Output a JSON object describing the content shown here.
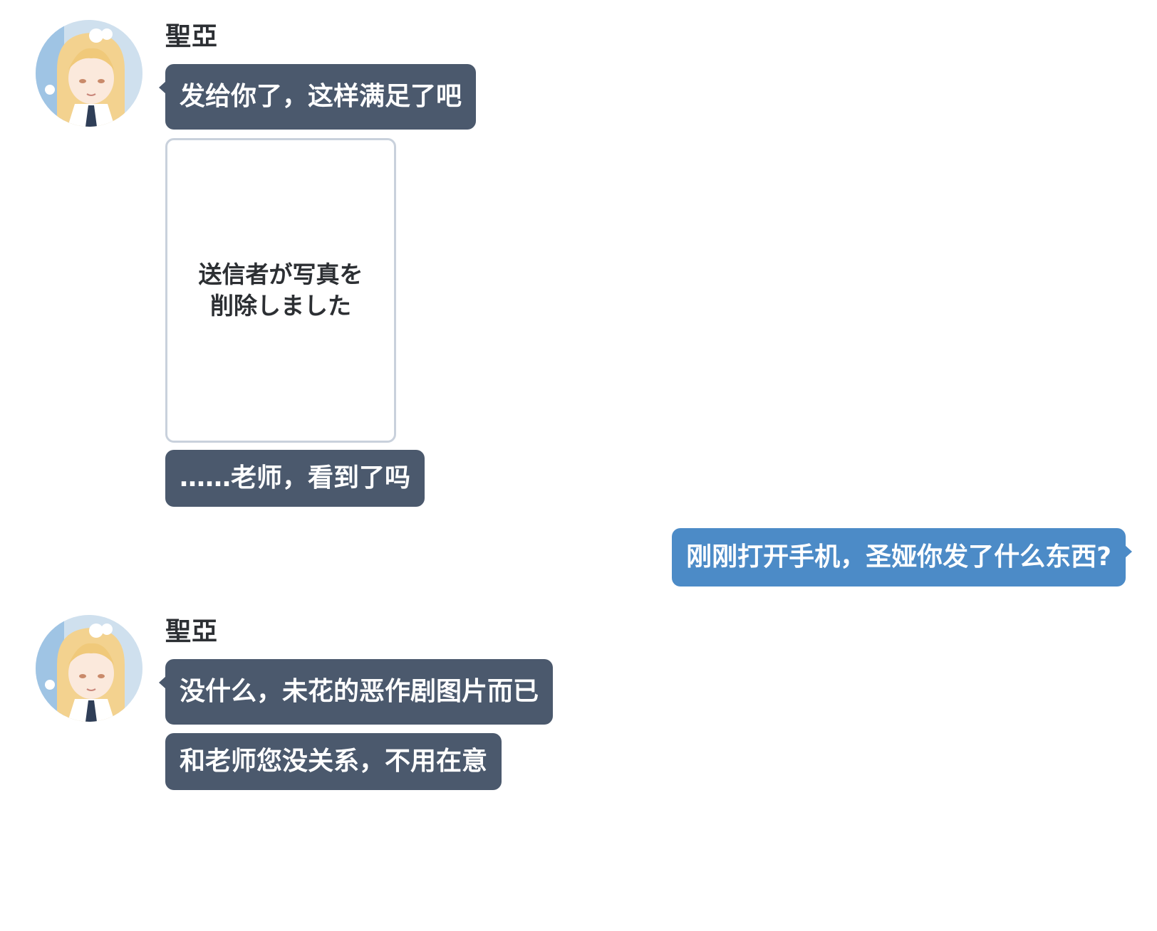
{
  "contact": {
    "name": "聖亞",
    "avatar_icon": "avatar-portrait-icon"
  },
  "colors": {
    "incoming_bubble": "#4b596d",
    "outgoing_bubble": "#4c8bc7",
    "photo_card_border": "#c9d1dc",
    "background": "#ffffff"
  },
  "messages": [
    {
      "sender": "聖亞",
      "type": "text",
      "text": "发给你了，这样满足了吧"
    },
    {
      "sender": "聖亞",
      "type": "deleted-photo",
      "text": "送信者が写真を\n削除しました"
    },
    {
      "sender": "聖亞",
      "type": "text",
      "text": "……老师，看到了吗"
    },
    {
      "sender": "me",
      "type": "text",
      "text": "刚刚打开手机，圣娅你发了什么东西?"
    },
    {
      "sender": "聖亞",
      "type": "text",
      "text": "没什么，未花的恶作剧图片而已"
    },
    {
      "sender": "聖亞",
      "type": "text",
      "text": "和老师您没关系，不用在意"
    }
  ]
}
